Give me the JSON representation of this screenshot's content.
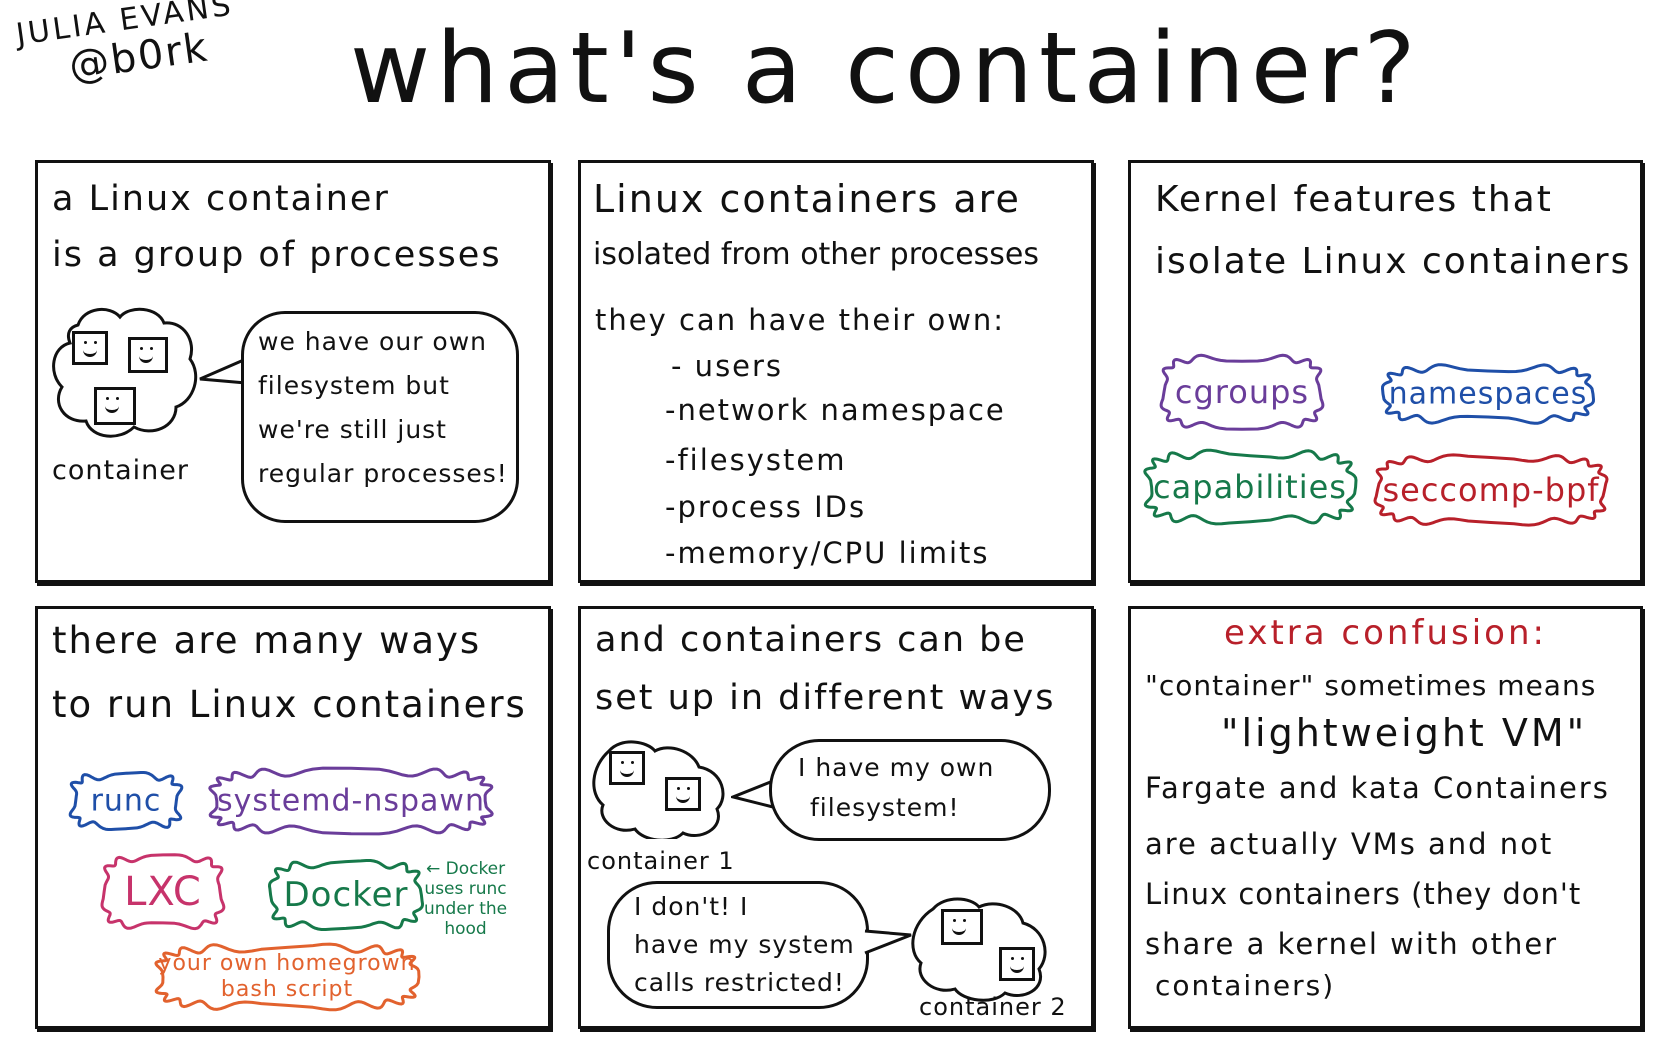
{
  "author": {
    "name": "JULIA EVANS",
    "handle": "@b0rk"
  },
  "title": "what's a container?",
  "colors": {
    "ink": "#111111",
    "purple": "#6a3d9a",
    "blue": "#1f4fa8",
    "green": "#16794a",
    "red": "#b8202a",
    "pink": "#c7336b",
    "orange": "#e2622e"
  },
  "panels": [
    {
      "heading": [
        "a Linux container",
        "is a group of processes"
      ],
      "cloud_label": "container",
      "bubble": [
        "we have our own",
        "filesystem but",
        "we're still just",
        "regular processes!"
      ]
    },
    {
      "heading": [
        "Linux containers are",
        "isolated from other processes"
      ],
      "intro": "they can have their own:",
      "items": [
        "- users",
        "-network namespace",
        "-filesystem",
        "-process IDs",
        "-memory/CPU limits"
      ]
    },
    {
      "heading": [
        "Kernel features that",
        "isolate Linux containers"
      ],
      "features": [
        {
          "label": "cgroups",
          "color": "#6a3d9a"
        },
        {
          "label": "namespaces",
          "color": "#1f4fa8"
        },
        {
          "label": "capabilities",
          "color": "#16794a"
        },
        {
          "label": "seccomp-bpf",
          "color": "#b8202a"
        }
      ]
    },
    {
      "heading": [
        "there are many ways",
        "to run Linux containers"
      ],
      "runtimes": [
        {
          "label": "runc",
          "color": "#1f4fa8"
        },
        {
          "label": "systemd-nspawn",
          "color": "#6a3d9a"
        },
        {
          "label": "LXC",
          "color": "#c7336b"
        },
        {
          "label": "Docker",
          "color": "#16794a"
        },
        {
          "label": "your own homegrown",
          "label2": "bash script",
          "color": "#e2622e"
        }
      ],
      "docker_note": [
        "← Docker",
        "uses runc",
        "under the",
        "hood"
      ]
    },
    {
      "heading": [
        "and containers can be",
        "set up in different ways"
      ],
      "container1_label": "container 1",
      "container1_bubble": [
        "I have my own",
        "filesystem!"
      ],
      "container2_label": "container 2",
      "container2_bubble": [
        "I don't! I",
        "have my system",
        "calls restricted!"
      ]
    },
    {
      "title": "extra confusion:",
      "lines": [
        "\"container\" sometimes means",
        "\"lightweight VM\"",
        "Fargate and kata Containers",
        "are actually VMs and not",
        "Linux containers (they don't",
        "share a kernel with other",
        "containers)"
      ]
    }
  ]
}
